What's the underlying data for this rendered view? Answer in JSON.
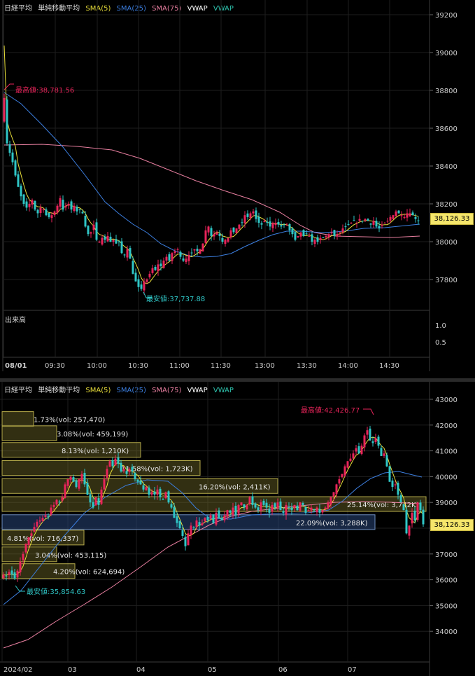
{
  "legend": {
    "name": "日経平均",
    "sma_label": "単純移動平均",
    "sma5": "SMA(5)",
    "sma25": "SMA(25)",
    "sma75": "SMA(75)",
    "vwap1": "VWAP",
    "vwap2": "VWAP"
  },
  "colors": {
    "up": "#e8245a",
    "down": "#2fc6c6",
    "sma5": "#e9df3a",
    "sma25": "#3c7fe0",
    "sma75": "#e87fa0",
    "vwap": "#ffffff",
    "vwap2": "#2fc6b0",
    "price_tag": "#f5e66b",
    "grid": "#1e1e1e",
    "high_label": "#e8245a",
    "low_label": "#2fc6c6"
  },
  "intraday": {
    "y_ticks": [
      "39200",
      "39000",
      "38800",
      "38600",
      "38400",
      "38200",
      "38000",
      "37800"
    ],
    "x_ticks": [
      "08/01",
      "09:30",
      "10:00",
      "10:30",
      "11:00",
      "11:30",
      "13:00",
      "13:30",
      "14:00",
      "14:30"
    ],
    "volume_label": "出来高",
    "volume_ticks": [
      "1.0",
      "0.5"
    ],
    "high_label": "最高値:38,781.56",
    "low_label": "最安値:37,737.88",
    "last_price": "38,126.33"
  },
  "daily": {
    "y_ticks": [
      "43000",
      "42000",
      "41000",
      "40000",
      "39000",
      "38000",
      "37000",
      "36000",
      "35000",
      "34000"
    ],
    "x_ticks": [
      "2024/02",
      "03",
      "04",
      "05",
      "06",
      "07"
    ],
    "high_label": "最高値:42,426.77",
    "low_label": "最安値:35,854.63",
    "last_price": "38,126.33",
    "volume_profile": [
      {
        "label": "1.73%(vol: 257,470)",
        "price": 42250
      },
      {
        "label": "3.08%(vol: 459,199)",
        "price": 41700
      },
      {
        "label": "8.13%(vol: 1,210K)",
        "price": 41050
      },
      {
        "label": "11.58%(vol: 1,723K)",
        "price": 40350
      },
      {
        "label": "16.20%(vol: 2,411K)",
        "price": 39650
      },
      {
        "label": "25.14%(vol: 3,742K)",
        "price": 38950
      },
      {
        "label": "22.09%(vol: 3,288K)",
        "price": 38250
      },
      {
        "label": "4.81%(vol: 716,337)",
        "price": 37650
      },
      {
        "label": "3.04%(vol: 453,115)",
        "price": 37000
      },
      {
        "label": "4.20%(vol: 624,694)",
        "price": 36350
      }
    ]
  }
}
